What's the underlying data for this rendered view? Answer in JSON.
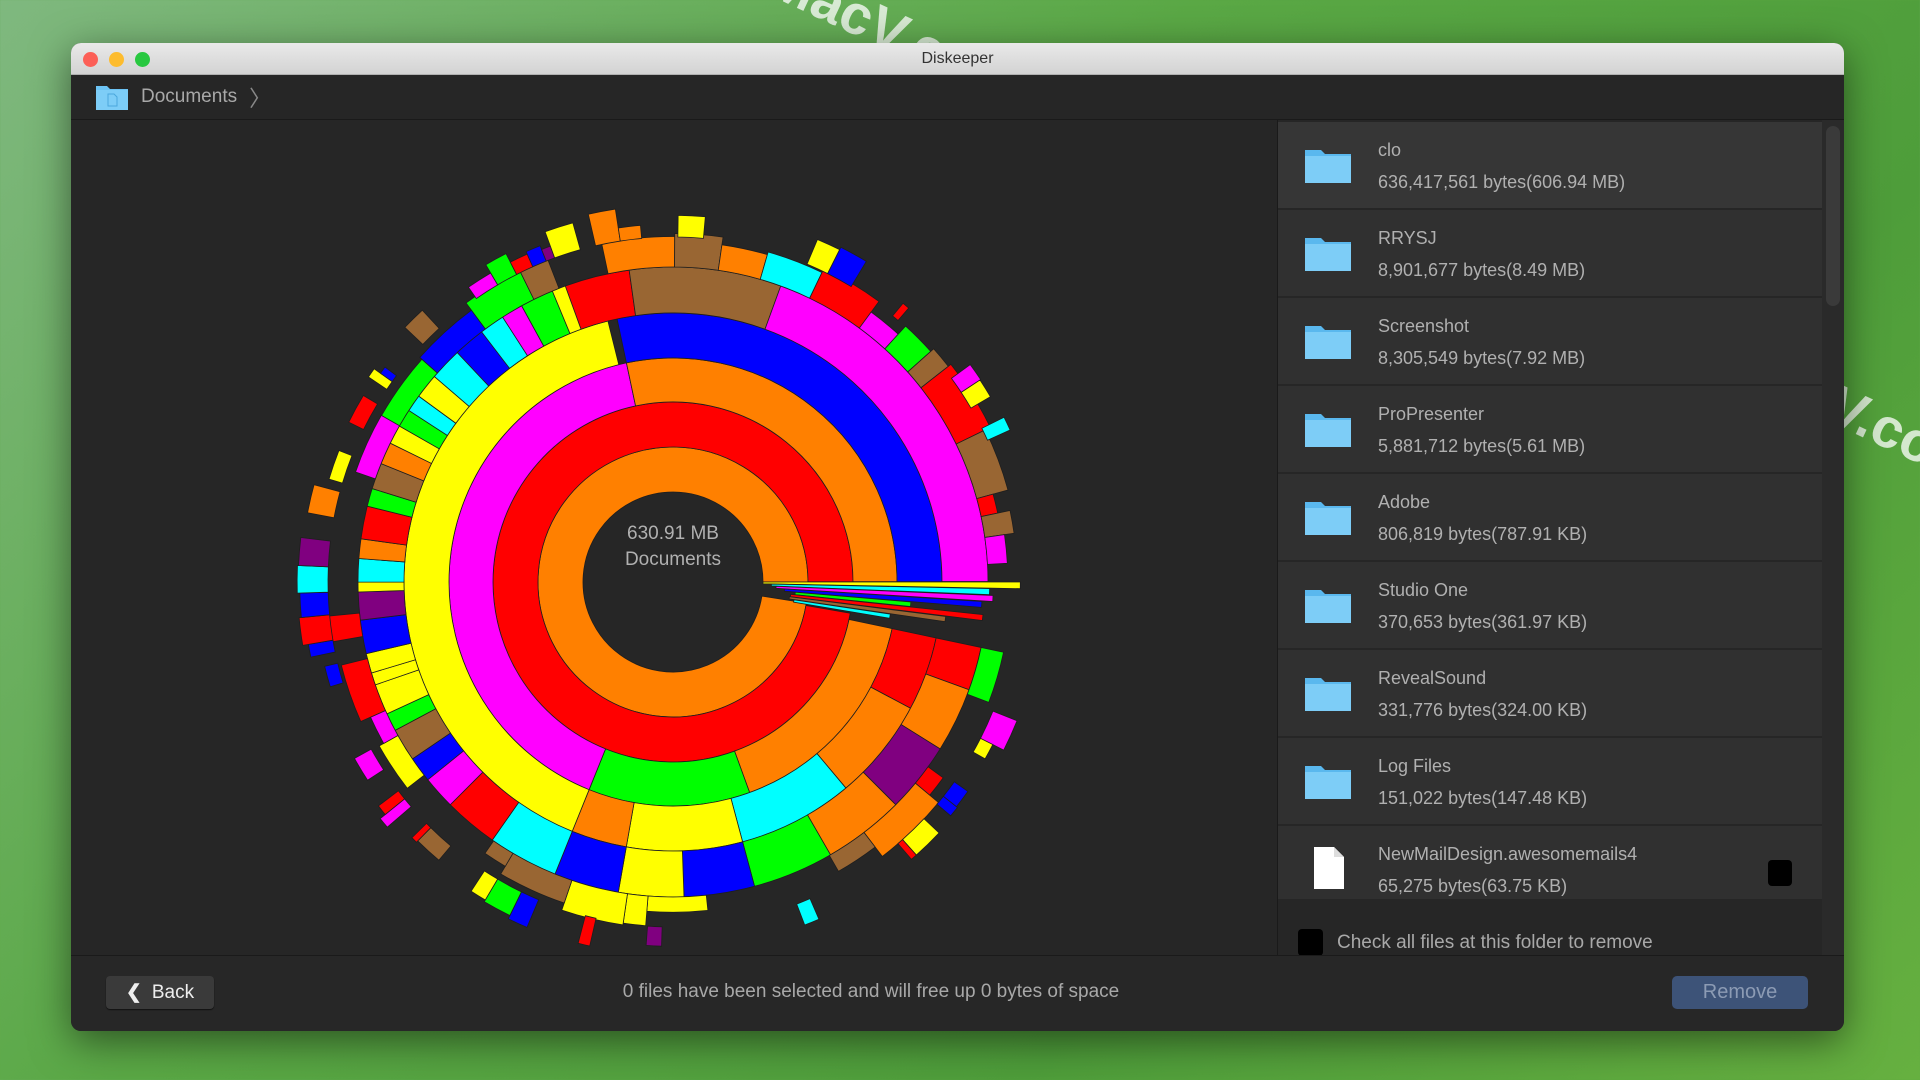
{
  "window": {
    "title": "Diskeeper"
  },
  "breadcrumb": {
    "items": [
      {
        "label": "Documents"
      }
    ]
  },
  "chart": {
    "total": "630.91 MB",
    "folder": "Documents"
  },
  "list": {
    "items": [
      {
        "name": "clo",
        "size": "636,417,561 bytes(606.94 MB)",
        "type": "folder"
      },
      {
        "name": "RRYSJ",
        "size": "8,901,677 bytes(8.49 MB)",
        "type": "folder"
      },
      {
        "name": "Screenshot",
        "size": "8,305,549 bytes(7.92 MB)",
        "type": "folder"
      },
      {
        "name": "ProPresenter",
        "size": "5,881,712 bytes(5.61 MB)",
        "type": "folder"
      },
      {
        "name": "Adobe",
        "size": "806,819 bytes(787.91 KB)",
        "type": "folder"
      },
      {
        "name": "Studio One",
        "size": "370,653 bytes(361.97 KB)",
        "type": "folder"
      },
      {
        "name": "RevealSound",
        "size": "331,776 bytes(324.00 KB)",
        "type": "folder"
      },
      {
        "name": "Log Files",
        "size": "151,022 bytes(147.48 KB)",
        "type": "folder"
      },
      {
        "name": "NewMailDesign.awesomemails4",
        "size": "65,275 bytes(63.75 KB)",
        "type": "file"
      }
    ],
    "check_all_label": "Check all files at this folder to remove"
  },
  "footer": {
    "back_label": "Back",
    "status": "0 files have been selected and will free up 0 bytes of space",
    "remove_label": "Remove"
  },
  "watermark": "MacV.com",
  "colors": {
    "accent": "#3d5378",
    "folder": "#6cc4f5"
  }
}
